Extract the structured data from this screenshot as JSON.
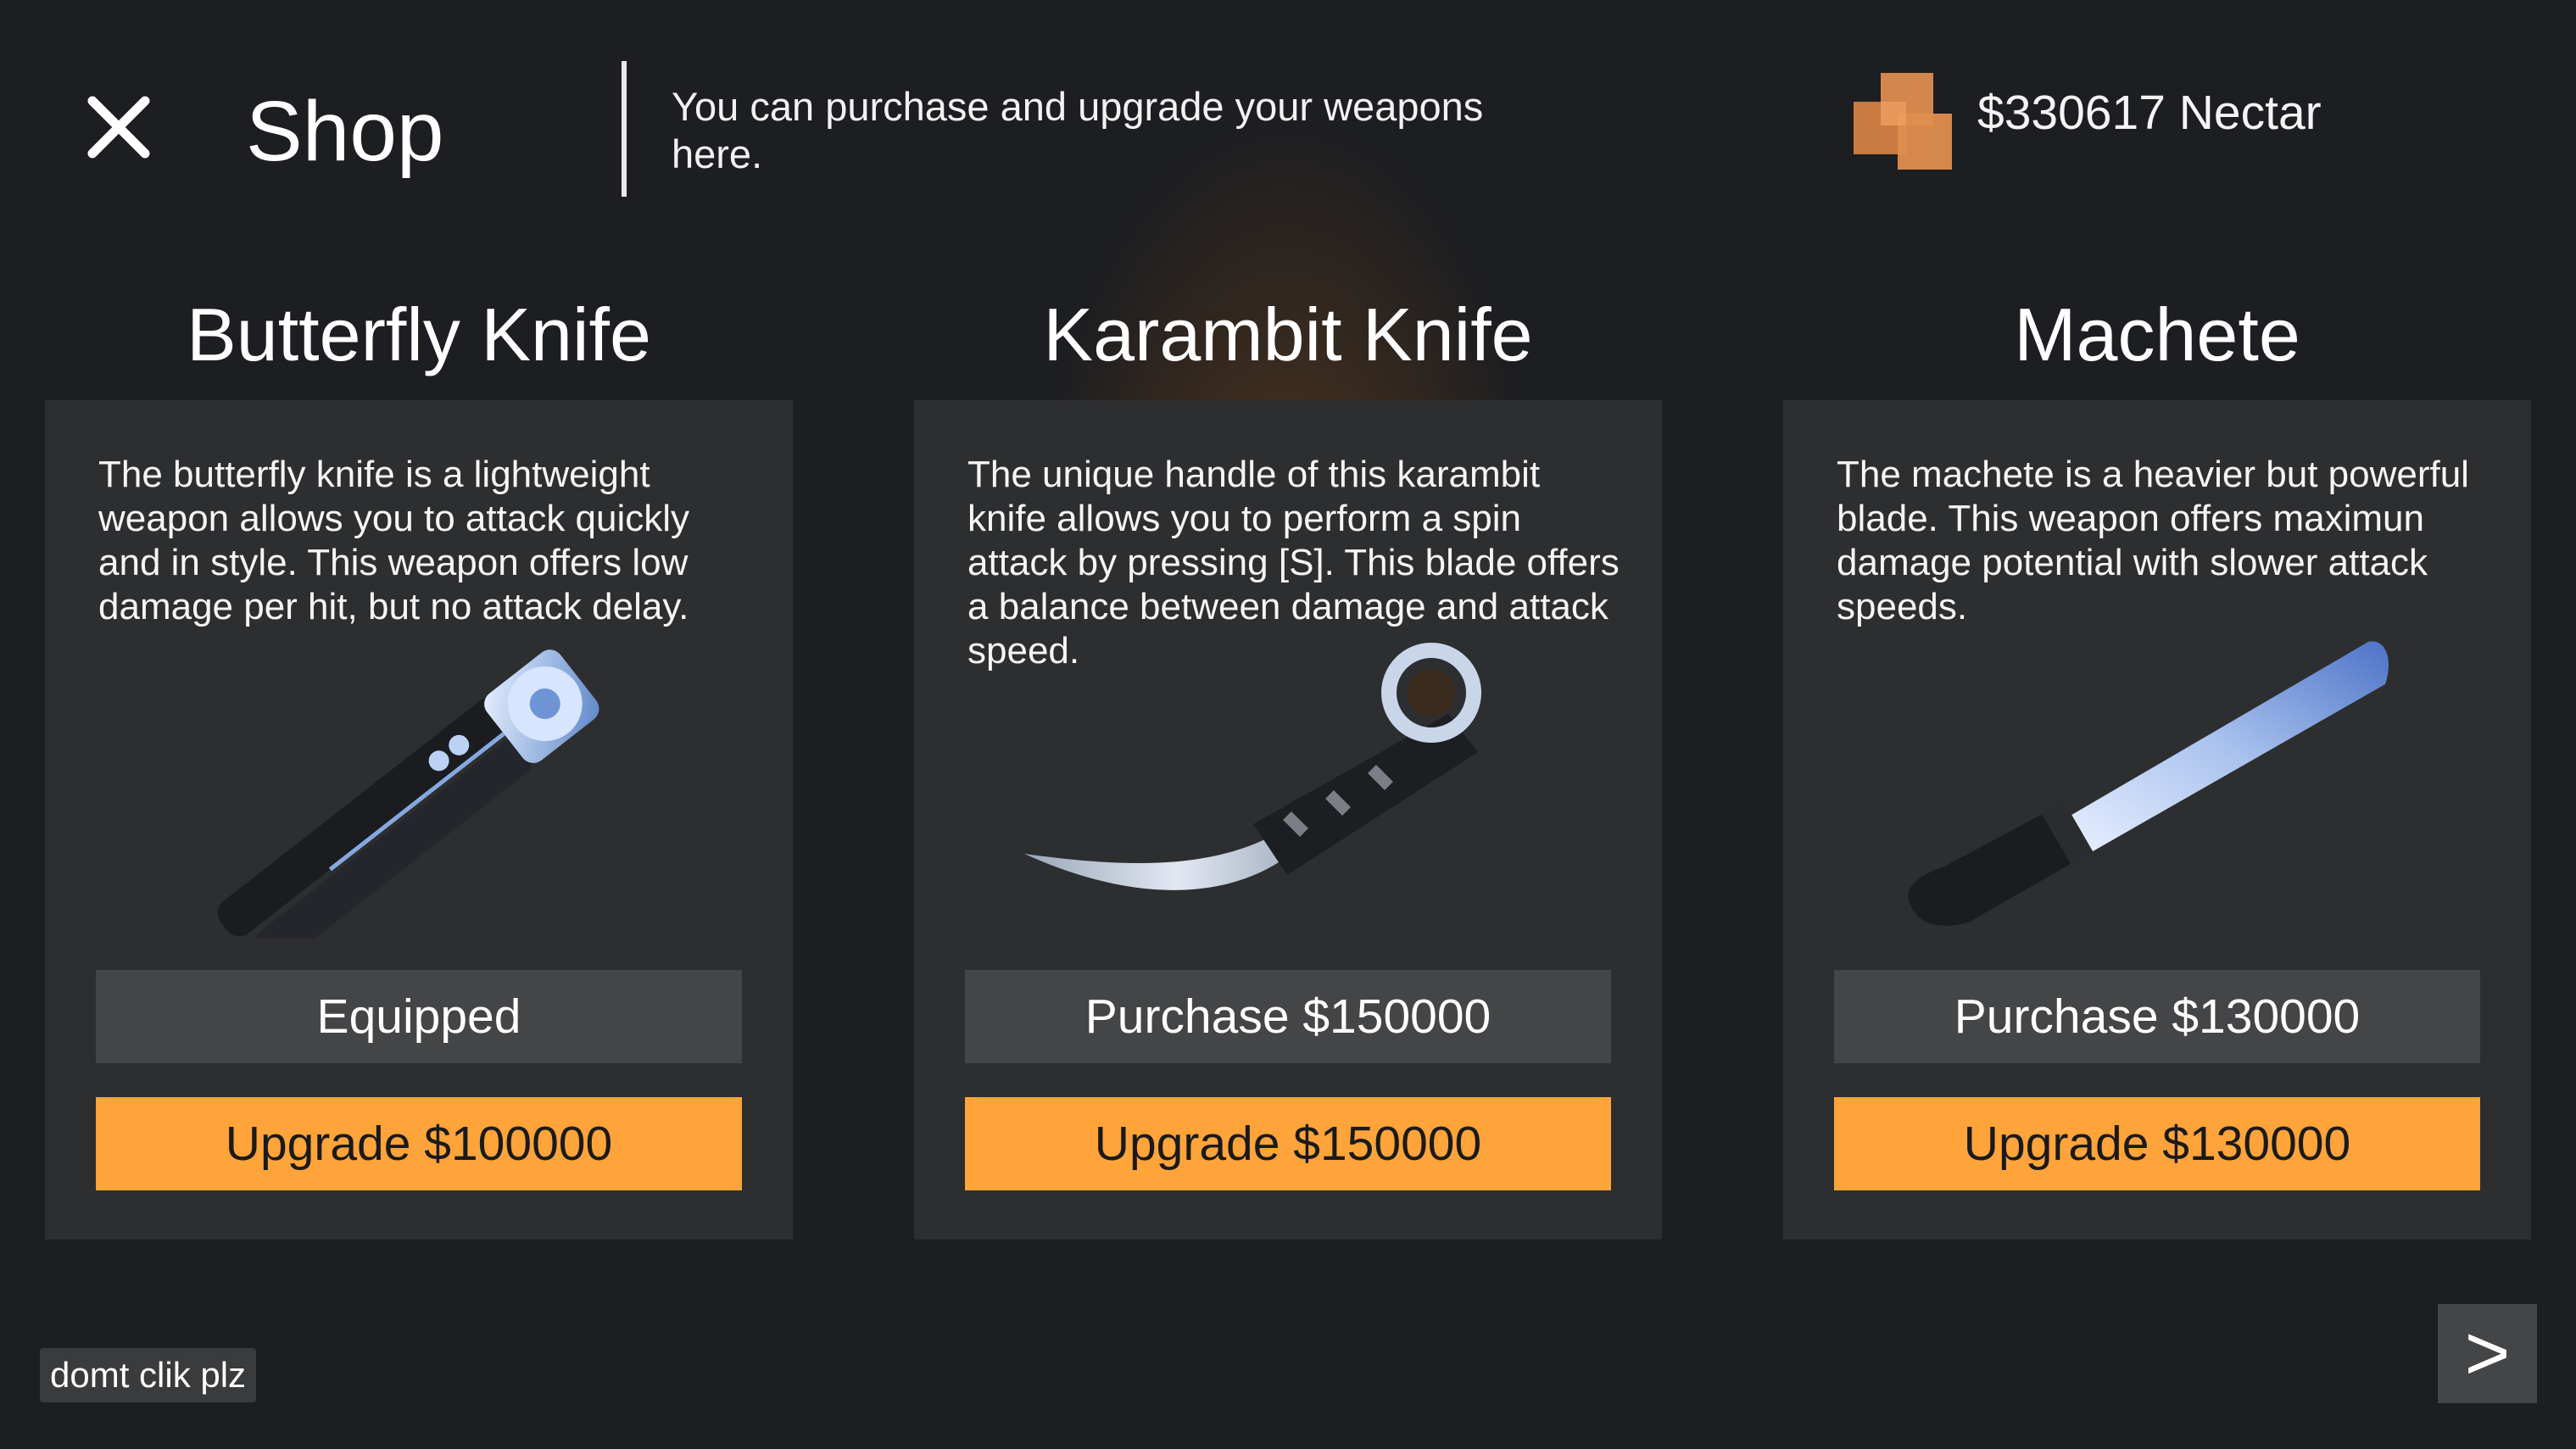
{
  "header": {
    "close_icon": "close-x-icon",
    "title": "Shop",
    "description": "You can purchase and upgrade your weapons here.",
    "currency_icon": "nectar-cubes-icon",
    "currency": "$330617 Nectar"
  },
  "cards": [
    {
      "title": "Butterfly Knife",
      "description": "The butterfly knife is a lightweight weapon allows you to attack quickly and in style. This weapon offers low damage per hit, but no attack delay.",
      "image_icon": "butterfly-knife-icon",
      "action_label": "Equipped",
      "upgrade_label": "Upgrade $100000"
    },
    {
      "title": "Karambit Knife",
      "description": "The unique handle of this karambit knife allows you to perform a spin attack by pressing [S]. This blade offers a balance between damage and attack speed.",
      "image_icon": "karambit-knife-icon",
      "action_label": "Purchase $150000",
      "upgrade_label": "Upgrade $150000"
    },
    {
      "title": "Machete",
      "description": "The machete is a heavier but powerful blade. This weapon offers maximun damage potential with slower attack speeds.",
      "image_icon": "machete-icon",
      "action_label": "Purchase $130000",
      "upgrade_label": "Upgrade $130000"
    }
  ],
  "footer": {
    "secret_button": "domt clik plz",
    "next_button": ">"
  },
  "colors": {
    "background": "#1d1e21",
    "card": "#2d2e30",
    "secondary_button": "#444547",
    "accent": "#ffa33b",
    "glow": "#c47428"
  }
}
